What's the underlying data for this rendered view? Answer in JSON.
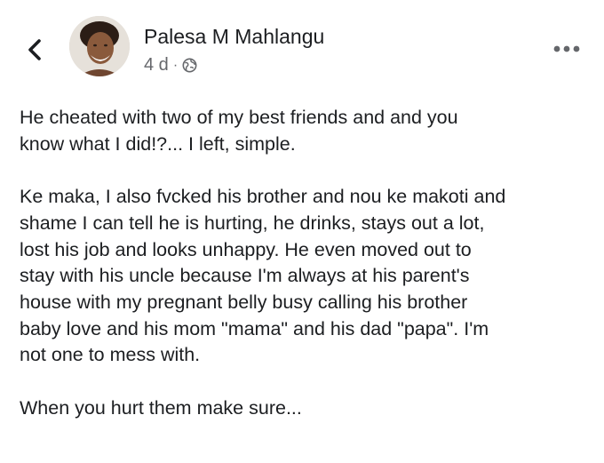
{
  "post": {
    "author": "Palesa M Mahlangu",
    "time": "4 d",
    "separator": "·",
    "paragraphs": [
      "He cheated with two of my best friends and and you\nknow what I did!?... I left, simple.",
      "Ke maka, I also fvcked his brother and nou ke makoti and\nshame I can tell he is hurting, he drinks, stays out a lot,\nlost his job and looks unhappy. He even moved out to\nstay with his uncle because I'm always at his parent's\nhouse with my pregnant belly busy calling his brother\nbaby love and his mom \"mama\" and his dad \"papa\". I'm\nnot one to mess with.",
      "When you hurt them make sure..."
    ]
  },
  "icons": {
    "back": "chevron-left-icon",
    "privacy": "globe-icon",
    "more": "more-horizontal-icon"
  },
  "colors": {
    "text_primary": "#1c1e21",
    "text_secondary": "#65676b",
    "background": "#ffffff"
  }
}
